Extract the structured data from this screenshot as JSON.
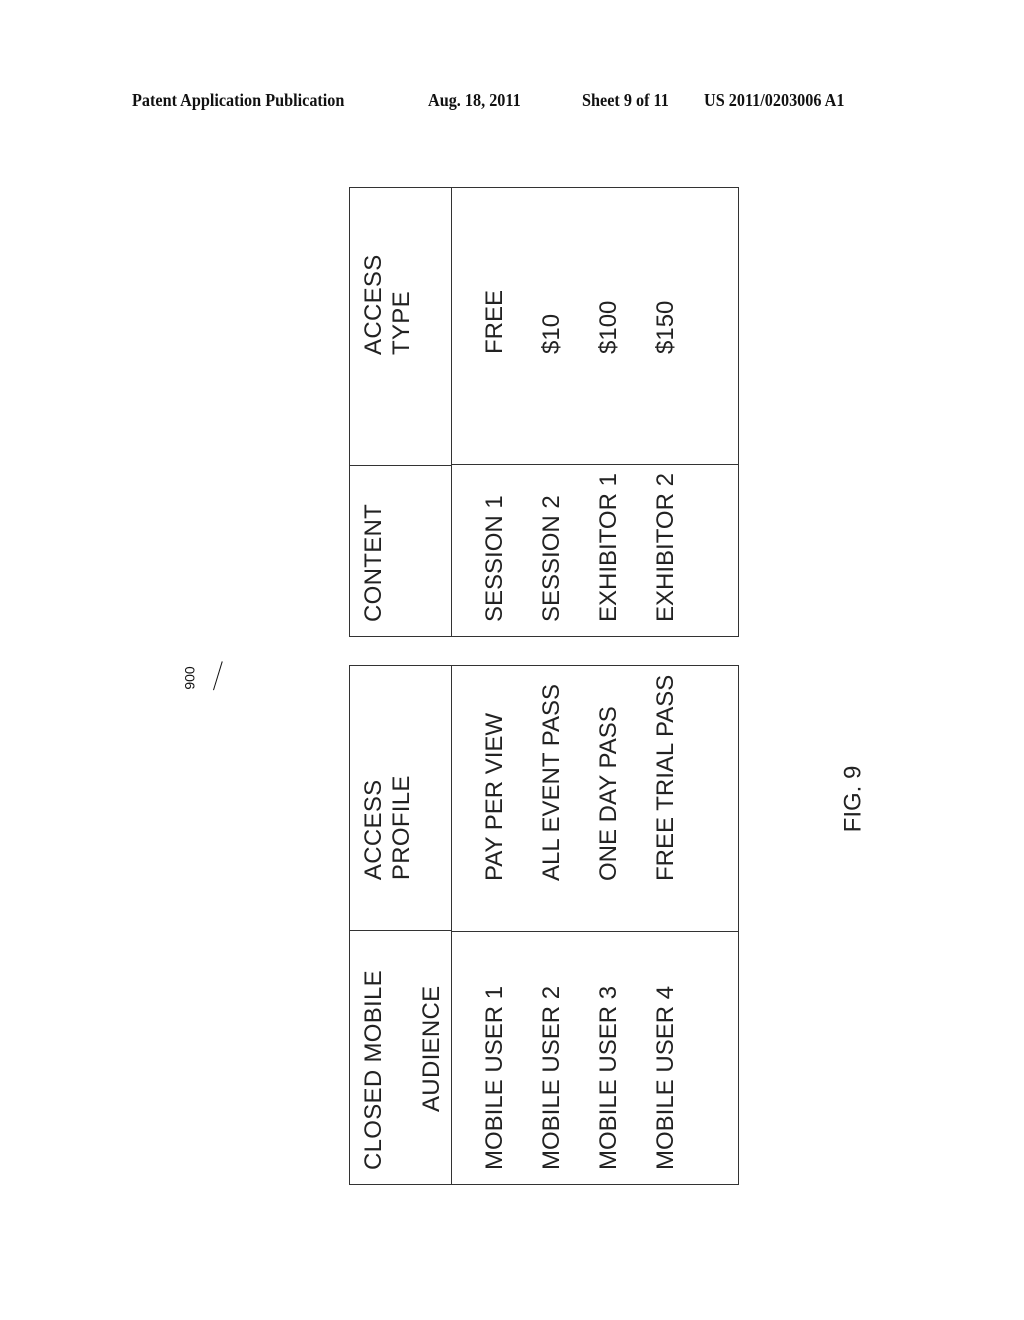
{
  "header": {
    "publication": "Patent Application Publication",
    "date": "Aug. 18, 2011",
    "sheet": "Sheet 9 of 11",
    "number": "US 2011/0203006 A1"
  },
  "figure": {
    "reference": "900",
    "label": "FIG. 9"
  },
  "table_audience": {
    "headers": [
      "CLOSED MOBILE",
      "AUDIENCE",
      "ACCESS PROFILE"
    ],
    "rows": [
      {
        "audience": "MOBILE USER 1",
        "profile": "PAY PER VIEW"
      },
      {
        "audience": "MOBILE USER 2",
        "profile": "ALL EVENT PASS"
      },
      {
        "audience": "MOBILE USER 3",
        "profile": "ONE DAY PASS"
      },
      {
        "audience": "MOBILE USER 4",
        "profile": "FREE TRIAL PASS"
      }
    ]
  },
  "table_content": {
    "headers": [
      "CONTENT",
      "ACCESS TYPE"
    ],
    "rows": [
      {
        "content": "SESSION 1",
        "type": "FREE"
      },
      {
        "content": "SESSION 2",
        "type": "$10"
      },
      {
        "content": "EXHIBITOR 1",
        "type": "$100"
      },
      {
        "content": "EXHIBITOR 2",
        "type": "$150"
      }
    ]
  }
}
